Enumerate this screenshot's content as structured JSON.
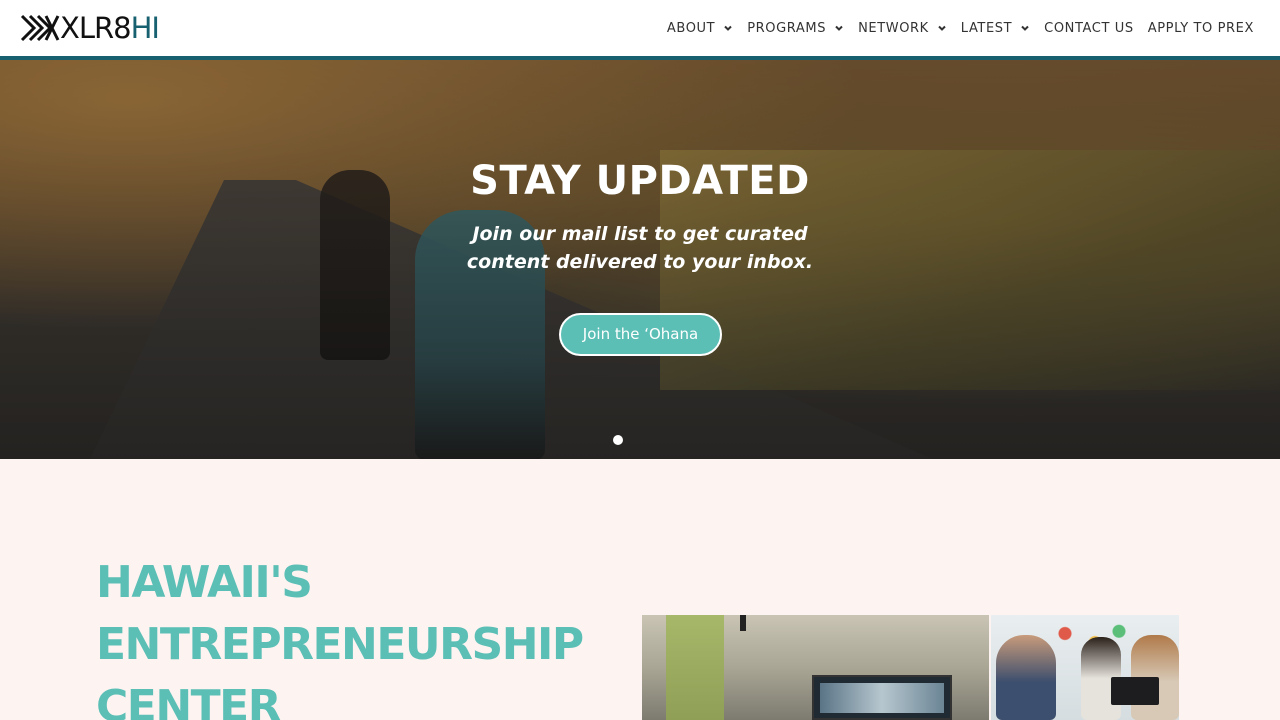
{
  "header": {
    "logo": {
      "text_main": "XLR8",
      "text_accent": "HI"
    },
    "nav": [
      {
        "label": "ABOUT",
        "has_dropdown": true
      },
      {
        "label": "PROGRAMS",
        "has_dropdown": true
      },
      {
        "label": "NETWORK",
        "has_dropdown": true
      },
      {
        "label": "LATEST",
        "has_dropdown": true
      },
      {
        "label": "CONTACT US",
        "has_dropdown": false
      },
      {
        "label": "APPLY TO PREX",
        "has_dropdown": false
      }
    ]
  },
  "hero": {
    "title": "STAY UPDATED",
    "subtitle": "Join our mail list to get curated content delivered to your inbox.",
    "button_label": "Join the ‘Ohana",
    "slider_active_index": 1
  },
  "main": {
    "title": "HAWAII'S ENTREPRENEURSHIP CENTER"
  },
  "colors": {
    "accent_teal": "#5bbfb6",
    "header_bar": "#17606f",
    "page_background": "#fdf3f1"
  },
  "icons": {
    "nav_dropdown": "chevron-down-icon",
    "logo": "xlr8hi-logo-icon"
  }
}
